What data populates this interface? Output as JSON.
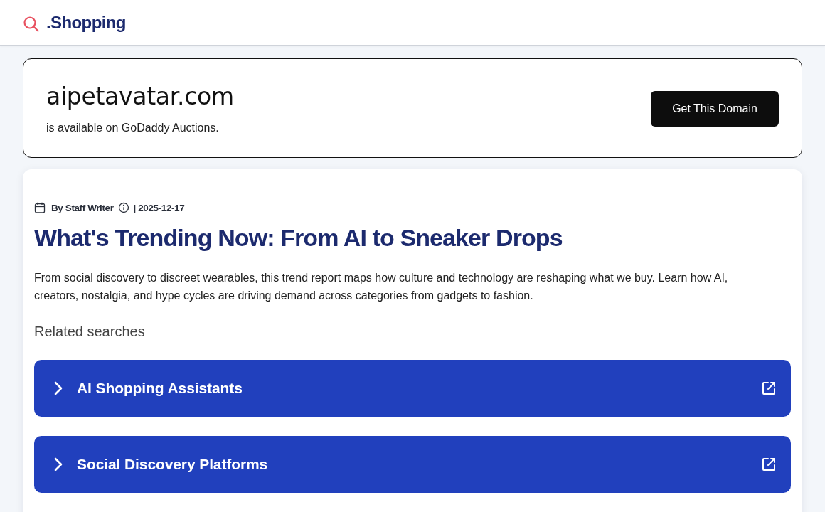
{
  "header": {
    "logo_text": ".Shopping"
  },
  "domain_banner": {
    "domain": "aipetavatar.com",
    "subtitle": "is available on GoDaddy Auctions.",
    "button": "Get This Domain"
  },
  "article": {
    "author": "By Staff Writer",
    "date": "| 2025-12-17",
    "title": "What's Trending Now: From AI to Sneaker Drops",
    "summary": "From social discovery to discreet wearables, this trend report maps how culture and technology are reshaping what we buy. Learn how AI, creators, nostalgia, and hype cycles are driving demand across categories from gadgets to fashion.",
    "related_heading": "Related searches",
    "related_searches": [
      {
        "label": "AI Shopping Assistants"
      },
      {
        "label": "Social Discovery Platforms"
      }
    ]
  }
}
